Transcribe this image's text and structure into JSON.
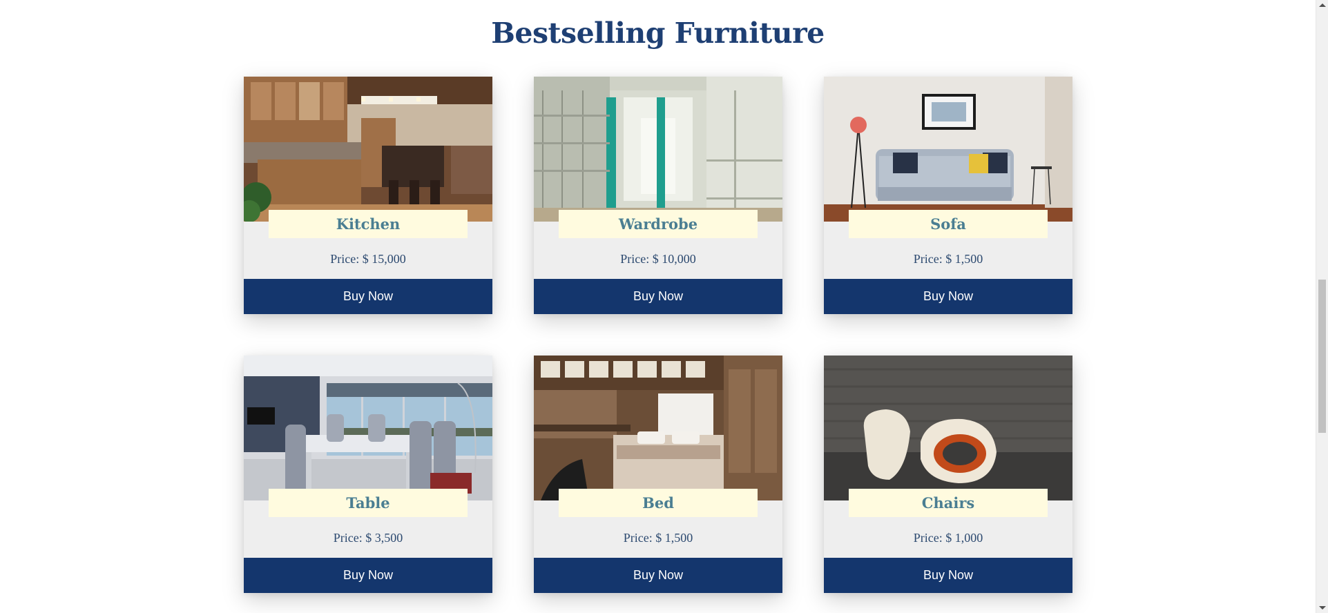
{
  "section": {
    "title": "Bestselling Furniture"
  },
  "products": [
    {
      "name": "Kitchen",
      "price": "Price: $ 15,000",
      "button": "Buy Now",
      "image": "kitchen-photo"
    },
    {
      "name": "Wardrobe",
      "price": "Price: $ 10,000",
      "button": "Buy Now",
      "image": "wardrobe-photo"
    },
    {
      "name": "Sofa",
      "price": "Price: $ 1,500",
      "button": "Buy Now",
      "image": "sofa-photo"
    },
    {
      "name": "Table",
      "price": "Price: $ 3,500",
      "button": "Buy Now",
      "image": "dining-table-photo"
    },
    {
      "name": "Bed",
      "price": "Price: $ 1,500",
      "button": "Buy Now",
      "image": "bed-photo"
    },
    {
      "name": "Chairs",
      "price": "Price: $ 1,000",
      "button": "Buy Now",
      "image": "chairs-photo"
    }
  ],
  "colors": {
    "heading": "#1e3f73",
    "button_bg": "#14366d",
    "name_box_bg": "#fffbdf",
    "name_text": "#4a7e92",
    "card_bg": "#eeeeee"
  }
}
